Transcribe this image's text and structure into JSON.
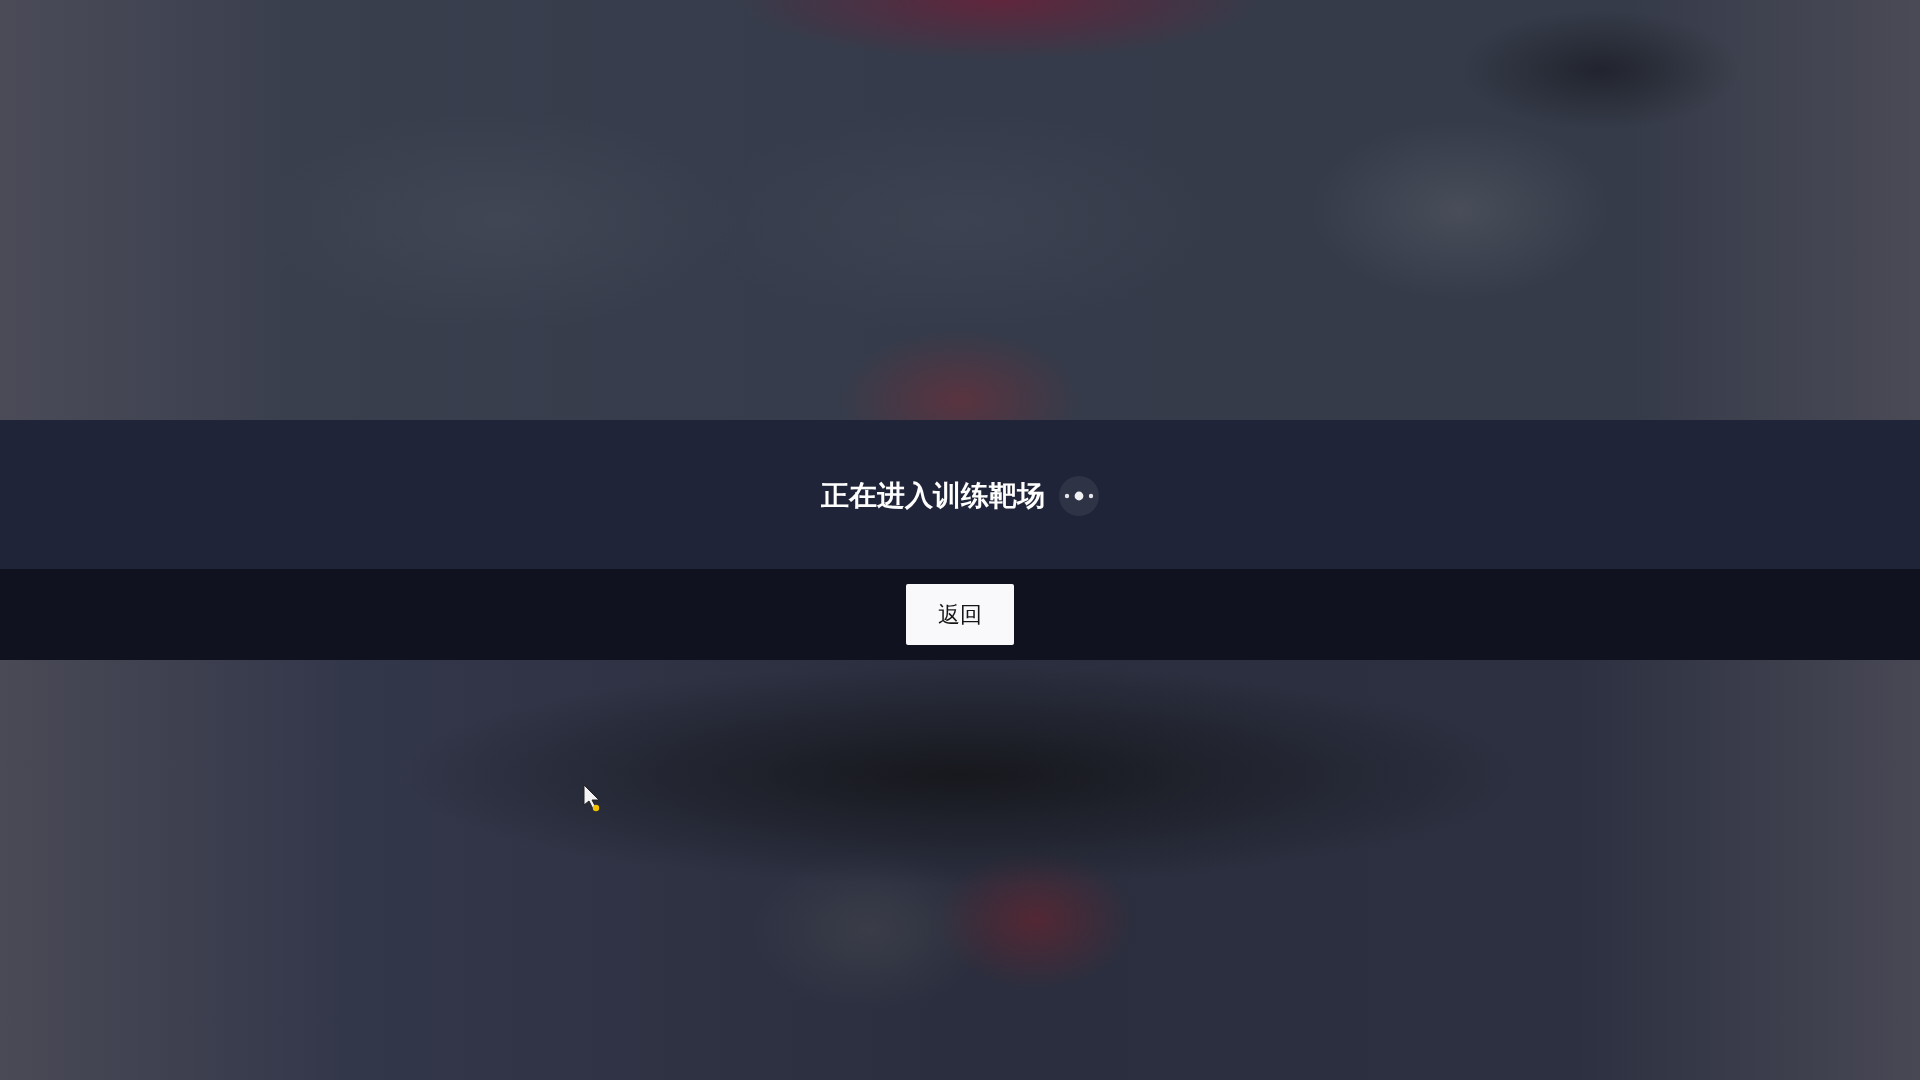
{
  "loading_banner": {
    "message": "正在进入训练靶场"
  },
  "action_bar": {
    "back_button": "返回"
  }
}
